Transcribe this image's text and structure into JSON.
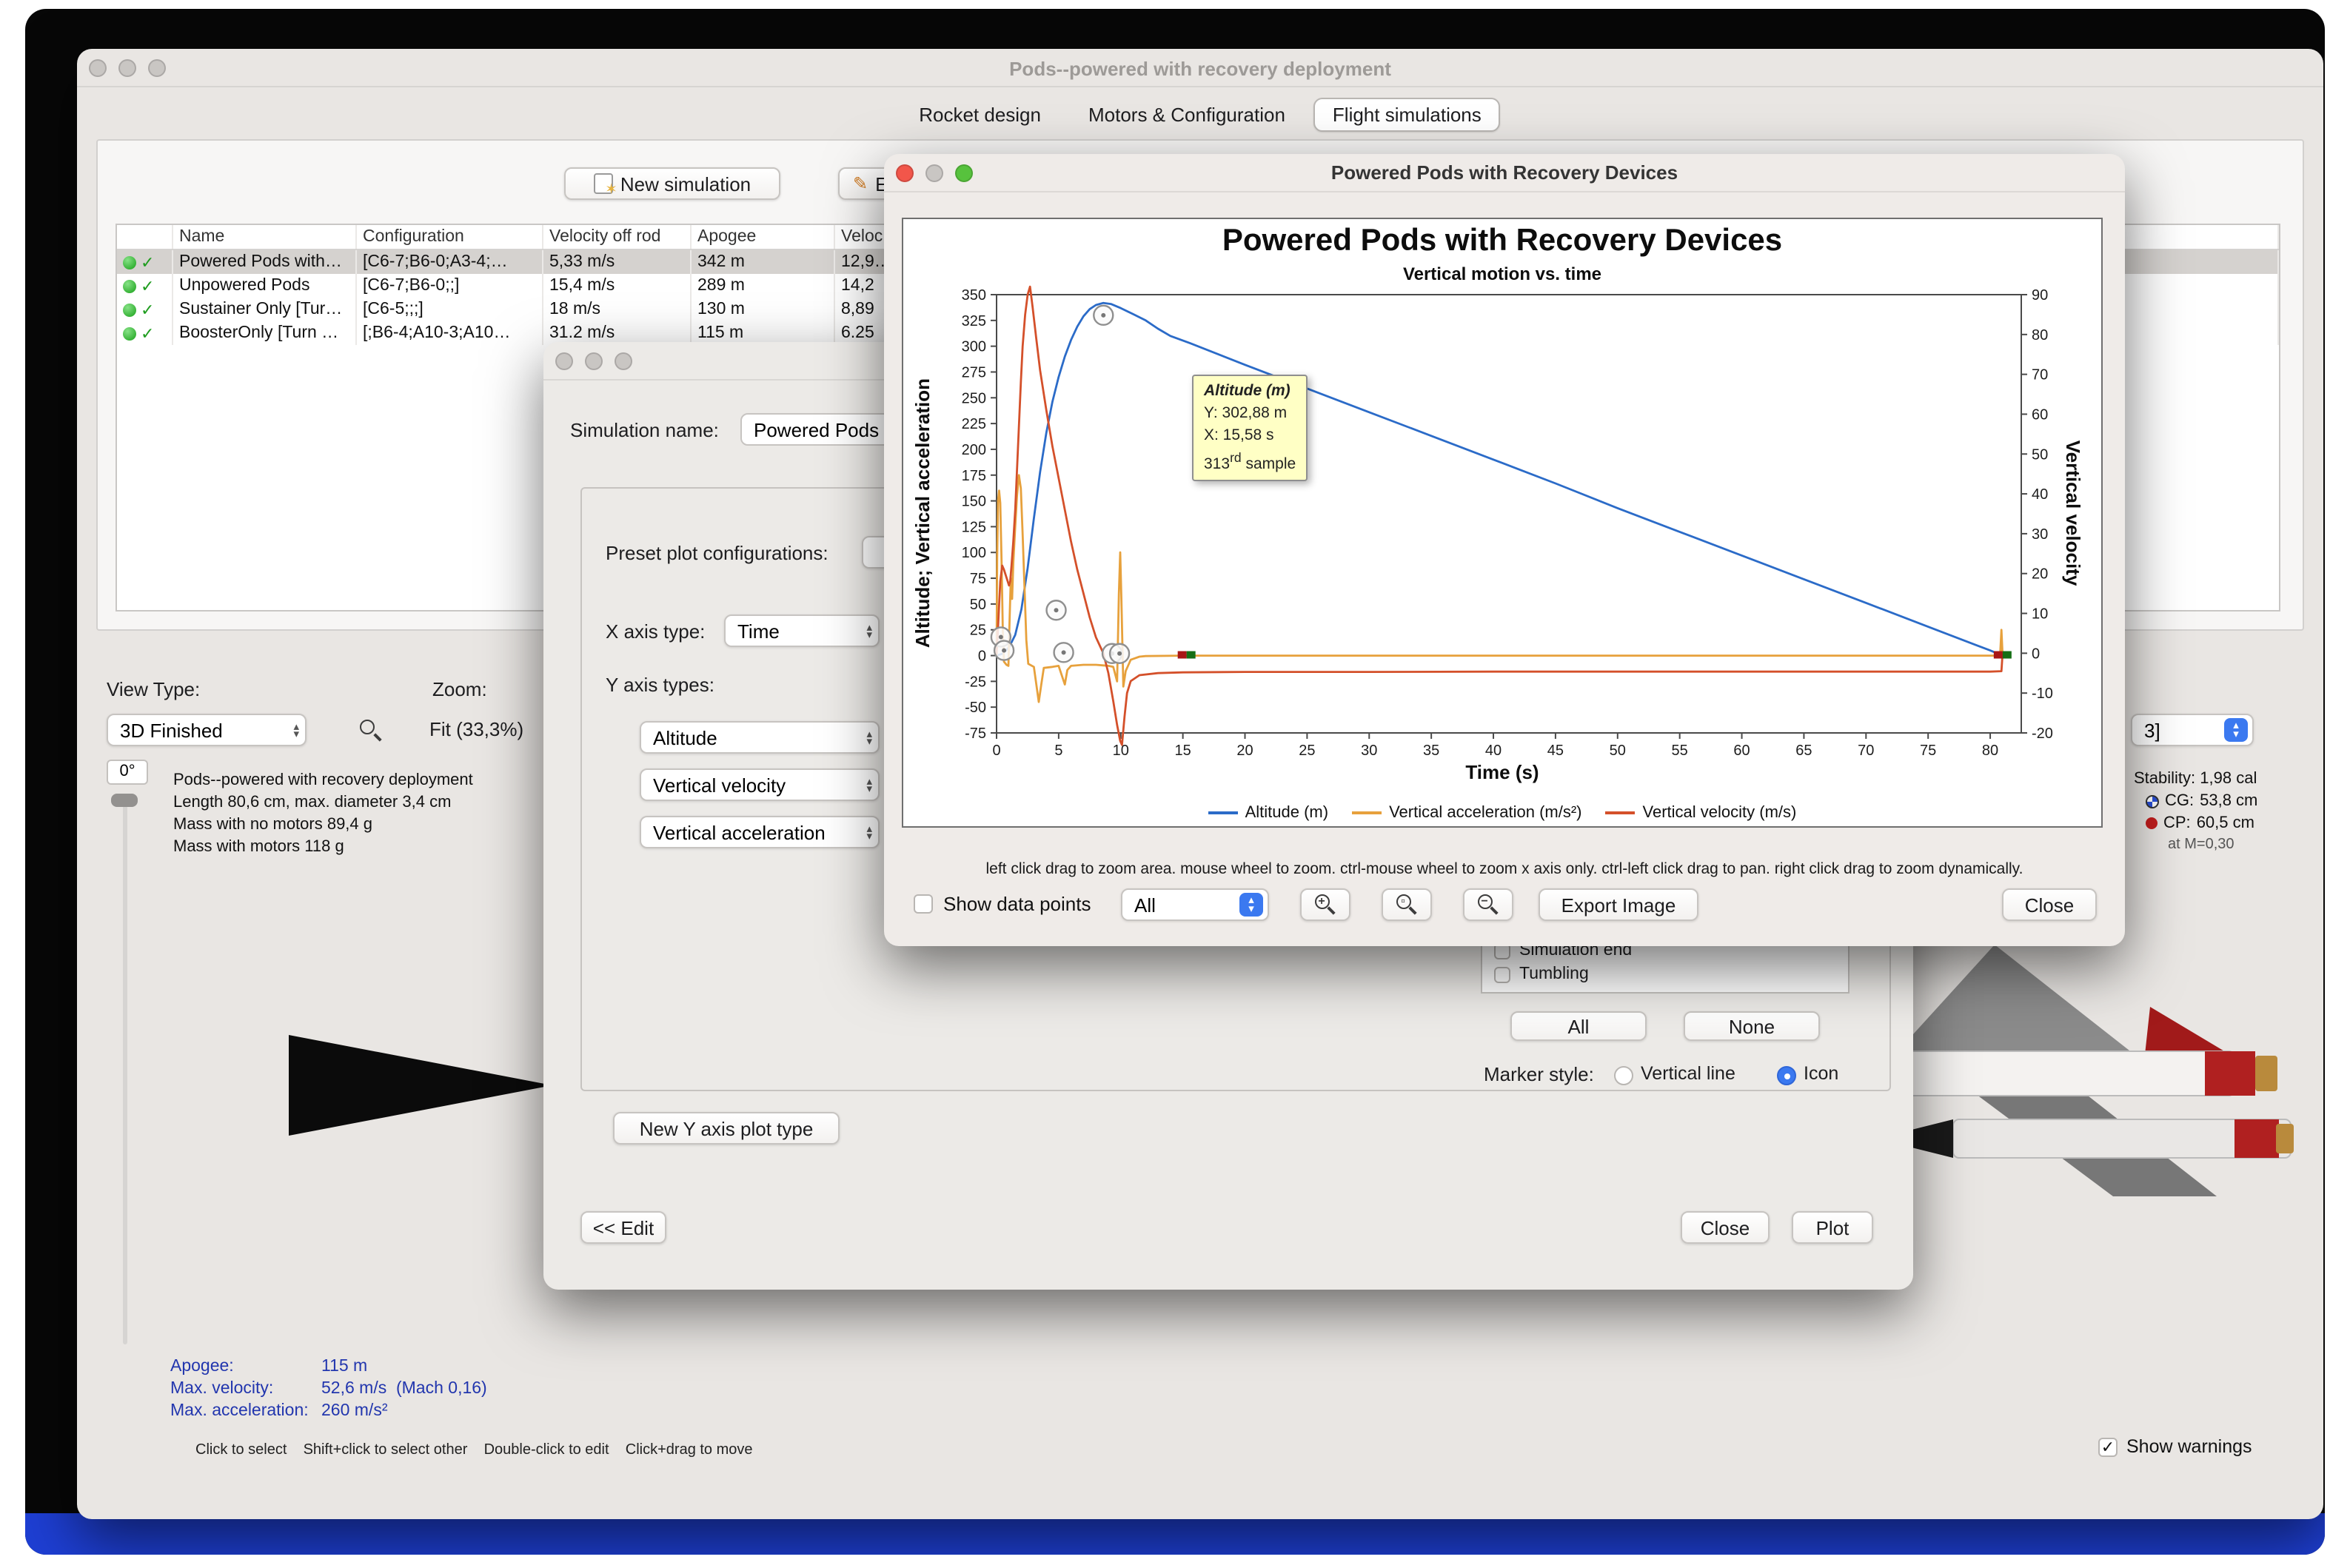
{
  "icons": {
    "check": "✓",
    "chev_up": "▴",
    "chev_down": "▾",
    "star": "✶",
    "pencil": "✎",
    "zoom_in": "+",
    "zoom_box": "▫",
    "zoom_out": "−"
  },
  "main_window": {
    "title": "Pods--powered with recovery deployment",
    "tabs": [
      "Rocket design",
      "Motors & Configuration",
      "Flight simulations"
    ],
    "toolbar": {
      "new_simulation": "New simulation",
      "edit_partial": "E"
    },
    "table": {
      "columns": [
        "Name",
        "Configuration",
        "Velocity off rod",
        "Apogee",
        "Veloc"
      ],
      "rows": [
        {
          "name": "Powered Pods with…",
          "config": "[C6-7;B6-0;A3-4;…",
          "vrod": "5,33 m/s",
          "apogee": "342 m",
          "vdep": "12,9…"
        },
        {
          "name": "Unpowered Pods",
          "config": "[C6-7;B6-0;;]",
          "vrod": "15,4 m/s",
          "apogee": "289 m",
          "vdep": "14,2"
        },
        {
          "name": "Sustainer Only [Tur…",
          "config": "[C6-5;;;]",
          "vrod": "18 m/s",
          "apogee": "130 m",
          "vdep": "8,89"
        },
        {
          "name": "BoosterOnly [Turn …",
          "config": "[;B6-4;A10-3;A10…",
          "vrod": "31.2 m/s",
          "apogee": "115 m",
          "vdep": "6.25"
        }
      ]
    },
    "view": {
      "view_type_label": "View Type:",
      "view_type": "3D Finished",
      "zoom_label": "Zoom:",
      "zoom_value": "Fit (33,3%)",
      "rotation": "0°",
      "info": [
        "Pods--powered with recovery deployment",
        "Length 80,6 cm, max. diameter 3,4 cm",
        "Mass with no motors 89,4 g",
        "Mass with motors 118 g"
      ]
    },
    "stats": {
      "apogee_label": "Apogee:",
      "apogee": "115 m",
      "maxv_label": "Max. velocity:",
      "maxv": "52,6 m/s  (Mach 0,16)",
      "maxa_label": "Max. acceleration:",
      "maxa": "260 m/s²"
    },
    "status": {
      "hints": "Click to select    Shift+click to select other    Double-click to edit    Click+drag to move",
      "show_warnings": "Show warnings"
    },
    "stability": {
      "config_partial": "3]",
      "stability_label": "Stability:",
      "stability_value": "1,98 cal",
      "cg_label": "CG:",
      "cg_value": "53,8 cm",
      "cp_label": "CP:",
      "cp_value": "60,5 cm",
      "mach": "at M=0,30"
    }
  },
  "edit_dialog": {
    "sim_name_label": "Simulation name:",
    "sim_name_value": "Powered Pods w",
    "preset_label": "Preset plot configurations:",
    "preset_value": "",
    "x_axis_label": "X axis type:",
    "x_axis_value": "Time",
    "y_axis_label": "Y axis types:",
    "y_types": [
      "Altitude",
      "Vertical velocity",
      "Vertical acceleration"
    ],
    "new_y_button": "New Y axis plot type",
    "edit_button": "<< Edit",
    "close_button": "Close",
    "plot_button": "Plot",
    "events": [
      "Simulation end",
      "Tumbling"
    ],
    "all_button": "All",
    "none_button": "None",
    "marker_label": "Marker style:",
    "marker_line": "Vertical line",
    "marker_icon": "Icon"
  },
  "plot_window": {
    "title": "Powered Pods with Recovery Devices",
    "hint": "left click drag to zoom area. mouse wheel to zoom. ctrl-mouse wheel to zoom x axis only. ctrl-left click drag to pan.  right click drag to zoom dynamically.",
    "show_data_points": "Show data points",
    "filter_value": "All",
    "export_button": "Export Image",
    "close_button": "Close",
    "tooltip": {
      "title": "Altitude (m)",
      "y": "Y: 302,88 m",
      "x": "X: 15,58 s",
      "sample_num": "313",
      "sample_suffix": "rd",
      "sample_word": "sample"
    }
  },
  "chart_data": {
    "type": "line",
    "title": "Powered Pods with Recovery Devices",
    "subtitle": "Vertical motion vs. time",
    "xlabel": "Time (s)",
    "ylabel_left": "Altitude; Vertical acceleration",
    "ylabel_right": "Vertical velocity",
    "xlim": [
      0,
      82.5
    ],
    "ylim_left": [
      -75,
      350
    ],
    "ylim_right": [
      -20,
      90
    ],
    "xticks": [
      0,
      5,
      10,
      15,
      20,
      25,
      30,
      35,
      40,
      45,
      50,
      55,
      60,
      65,
      70,
      75,
      80
    ],
    "yticks_left": [
      -75,
      -50,
      -25,
      0,
      25,
      50,
      75,
      100,
      125,
      150,
      175,
      200,
      225,
      250,
      275,
      300,
      325,
      350
    ],
    "yticks_right": [
      -20,
      -10,
      0,
      10,
      20,
      30,
      40,
      50,
      60,
      70,
      80,
      90
    ],
    "legend": [
      {
        "label": "Altitude (m)",
        "color": "#2b6bc8"
      },
      {
        "label": "Vertical acceleration (m/s²)",
        "color": "#e7a13c"
      },
      {
        "label": "Vertical velocity (m/s)",
        "color": "#d4502a"
      }
    ],
    "series": [
      {
        "name": "Altitude (m)",
        "axis": "left",
        "color": "#2b6bc8",
        "points": [
          [
            0,
            0
          ],
          [
            0.5,
            2
          ],
          [
            1,
            8
          ],
          [
            1.5,
            20
          ],
          [
            2,
            45
          ],
          [
            2.5,
            85
          ],
          [
            3,
            133
          ],
          [
            3.5,
            178
          ],
          [
            4,
            216
          ],
          [
            4.5,
            246
          ],
          [
            5,
            270
          ],
          [
            5.5,
            290
          ],
          [
            6,
            306
          ],
          [
            6.5,
            319
          ],
          [
            7,
            329
          ],
          [
            7.5,
            336
          ],
          [
            8,
            340
          ],
          [
            8.6,
            342
          ],
          [
            9.2,
            341
          ],
          [
            10,
            337
          ],
          [
            11,
            331
          ],
          [
            12,
            325
          ],
          [
            13,
            317
          ],
          [
            14,
            310
          ],
          [
            15.58,
            302.9
          ],
          [
            20,
            282
          ],
          [
            25,
            259
          ],
          [
            30,
            236
          ],
          [
            35,
            213
          ],
          [
            40,
            190
          ],
          [
            45,
            167
          ],
          [
            50,
            143
          ],
          [
            55,
            120
          ],
          [
            60,
            97
          ],
          [
            65,
            74
          ],
          [
            70,
            51
          ],
          [
            75,
            28
          ],
          [
            80,
            5
          ],
          [
            81,
            0
          ]
        ]
      },
      {
        "name": "Vertical acceleration (m/s²)",
        "axis": "left",
        "color": "#e7a13c",
        "points": [
          [
            0,
            0
          ],
          [
            0.05,
            95
          ],
          [
            0.12,
            150
          ],
          [
            0.2,
            160
          ],
          [
            0.3,
            148
          ],
          [
            0.4,
            90
          ],
          [
            0.5,
            25
          ],
          [
            0.6,
            -6
          ],
          [
            0.8,
            -9
          ],
          [
            0.95,
            -10
          ],
          [
            1.05,
            35
          ],
          [
            1.15,
            75
          ],
          [
            1.25,
            55
          ],
          [
            1.35,
            90
          ],
          [
            1.5,
            125
          ],
          [
            1.65,
            155
          ],
          [
            1.8,
            175
          ],
          [
            1.95,
            162
          ],
          [
            2.1,
            118
          ],
          [
            2.25,
            65
          ],
          [
            2.4,
            15
          ],
          [
            2.55,
            -8
          ],
          [
            3,
            -11
          ],
          [
            3.4,
            -45
          ],
          [
            3.6,
            -28
          ],
          [
            3.8,
            -12
          ],
          [
            4.5,
            -11
          ],
          [
            5,
            -10
          ],
          [
            5.5,
            -28
          ],
          [
            5.7,
            -14
          ],
          [
            6,
            -10
          ],
          [
            7,
            -9
          ],
          [
            8,
            -9
          ],
          [
            8.6,
            -9.5
          ],
          [
            9,
            -10
          ],
          [
            9.4,
            -11
          ],
          [
            9.7,
            -25
          ],
          [
            9.85,
            60
          ],
          [
            9.95,
            100
          ],
          [
            10.05,
            55
          ],
          [
            10.2,
            -30
          ],
          [
            10.4,
            -15
          ],
          [
            10.8,
            -4
          ],
          [
            11.5,
            -1
          ],
          [
            12,
            -0.5
          ],
          [
            15,
            0
          ],
          [
            20,
            0
          ],
          [
            30,
            0
          ],
          [
            40,
            0
          ],
          [
            50,
            0
          ],
          [
            60,
            0
          ],
          [
            70,
            0
          ],
          [
            80,
            0
          ],
          [
            80.8,
            0
          ],
          [
            80.9,
            25
          ],
          [
            81,
            0
          ]
        ]
      },
      {
        "name": "Vertical velocity (m/s)",
        "axis": "right",
        "color": "#d4502a",
        "points": [
          [
            0,
            0
          ],
          [
            0.1,
            5
          ],
          [
            0.2,
            12
          ],
          [
            0.3,
            18
          ],
          [
            0.45,
            22
          ],
          [
            0.6,
            21
          ],
          [
            0.8,
            19
          ],
          [
            1,
            17
          ],
          [
            1.1,
            18
          ],
          [
            1.2,
            22
          ],
          [
            1.35,
            28
          ],
          [
            1.5,
            36
          ],
          [
            1.65,
            46
          ],
          [
            1.8,
            57
          ],
          [
            1.95,
            68
          ],
          [
            2.1,
            77
          ],
          [
            2.3,
            85
          ],
          [
            2.5,
            90
          ],
          [
            2.7,
            92
          ],
          [
            2.9,
            87
          ],
          [
            3.2,
            79
          ],
          [
            3.5,
            71
          ],
          [
            4,
            61
          ],
          [
            4.5,
            52
          ],
          [
            5,
            44
          ],
          [
            5.5,
            36
          ],
          [
            6,
            28
          ],
          [
            6.5,
            21
          ],
          [
            7,
            15
          ],
          [
            7.5,
            9
          ],
          [
            8,
            4
          ],
          [
            8.6,
            0
          ],
          [
            9,
            -5
          ],
          [
            9.4,
            -12
          ],
          [
            9.7,
            -18
          ],
          [
            9.95,
            -22
          ],
          [
            10.1,
            -23
          ],
          [
            10.3,
            -16
          ],
          [
            10.5,
            -10
          ],
          [
            10.8,
            -7
          ],
          [
            11.5,
            -5.5
          ],
          [
            13,
            -5
          ],
          [
            15,
            -4.8
          ],
          [
            20,
            -4.7
          ],
          [
            30,
            -4.7
          ],
          [
            40,
            -4.6
          ],
          [
            50,
            -4.6
          ],
          [
            60,
            -4.6
          ],
          [
            70,
            -4.6
          ],
          [
            80,
            -4.6
          ],
          [
            80.9,
            -4.5
          ],
          [
            81,
            0
          ]
        ]
      }
    ],
    "events": [
      {
        "t": 0.35,
        "v": 18,
        "axis": "left",
        "kind": "icon"
      },
      {
        "t": 0.6,
        "v": 5,
        "axis": "left",
        "kind": "icon"
      },
      {
        "t": 4.8,
        "v": 44,
        "axis": "left",
        "kind": "icon"
      },
      {
        "t": 5.4,
        "v": 3,
        "axis": "left",
        "kind": "icon"
      },
      {
        "t": 8.6,
        "v": 330,
        "axis": "left",
        "kind": "icon"
      },
      {
        "t": 9.3,
        "v": 2,
        "axis": "left",
        "kind": "icon"
      },
      {
        "t": 9.9,
        "v": 2,
        "axis": "left",
        "kind": "icon"
      },
      {
        "t": 15.3,
        "v": 0,
        "axis": "left",
        "kind": "ground"
      },
      {
        "t": 81,
        "v": 0,
        "axis": "left",
        "kind": "ground"
      }
    ]
  }
}
